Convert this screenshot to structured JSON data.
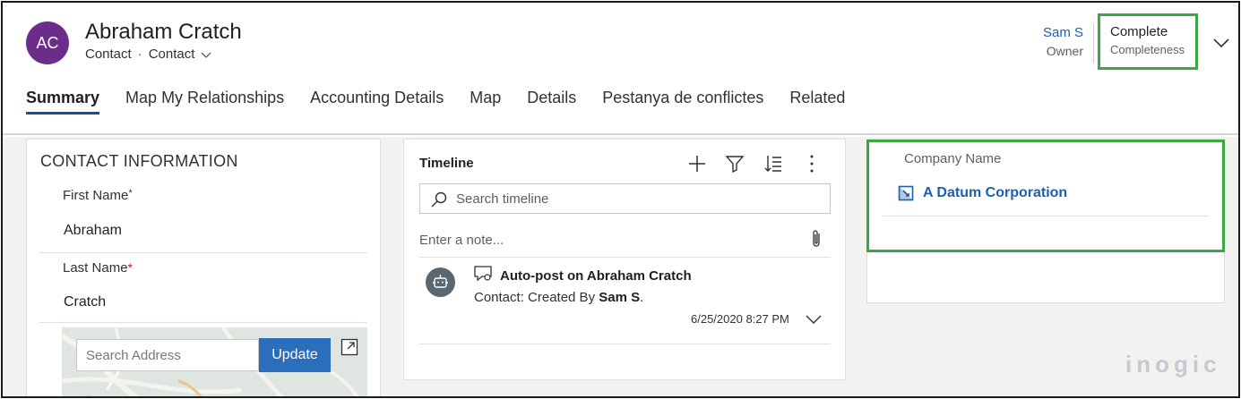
{
  "record": {
    "initials": "AC",
    "title": "Abraham Cratch",
    "entity": "Contact",
    "form": "Contact",
    "owner_name": "Sam S",
    "owner_label": "Owner",
    "completeness_value": "Complete",
    "completeness_label": "Completeness"
  },
  "tabs": [
    {
      "label": "Summary",
      "active": true
    },
    {
      "label": "Map My Relationships"
    },
    {
      "label": "Accounting Details"
    },
    {
      "label": "Map"
    },
    {
      "label": "Details"
    },
    {
      "label": "Pestanya de conflictes"
    },
    {
      "label": "Related"
    }
  ],
  "contact": {
    "section_title": "CONTACT INFORMATION",
    "first_name_label": "First Name",
    "first_name_value": "Abraham",
    "last_name_label": "Last Name",
    "last_name_value": "Cratch",
    "address_placeholder": "Search Address",
    "update_label": "Update"
  },
  "timeline": {
    "title": "Timeline",
    "search_placeholder": "Search timeline",
    "note_placeholder": "Enter a note...",
    "post_title": "Auto-post on Abraham Cratch",
    "post_body_prefix": "Contact: Created By ",
    "post_body_user": "Sam S",
    "post_body_suffix": ".",
    "post_date": "6/25/2020 8:27 PM"
  },
  "company": {
    "label": "Company Name",
    "value": "A Datum Corporation"
  },
  "brand": "inogic",
  "colors": {
    "avatar": "#6c2c8a",
    "highlight": "#3ba843",
    "link": "#1f5faa",
    "tab_underline": "#0f5298",
    "update_button": "#2b6fbc"
  }
}
